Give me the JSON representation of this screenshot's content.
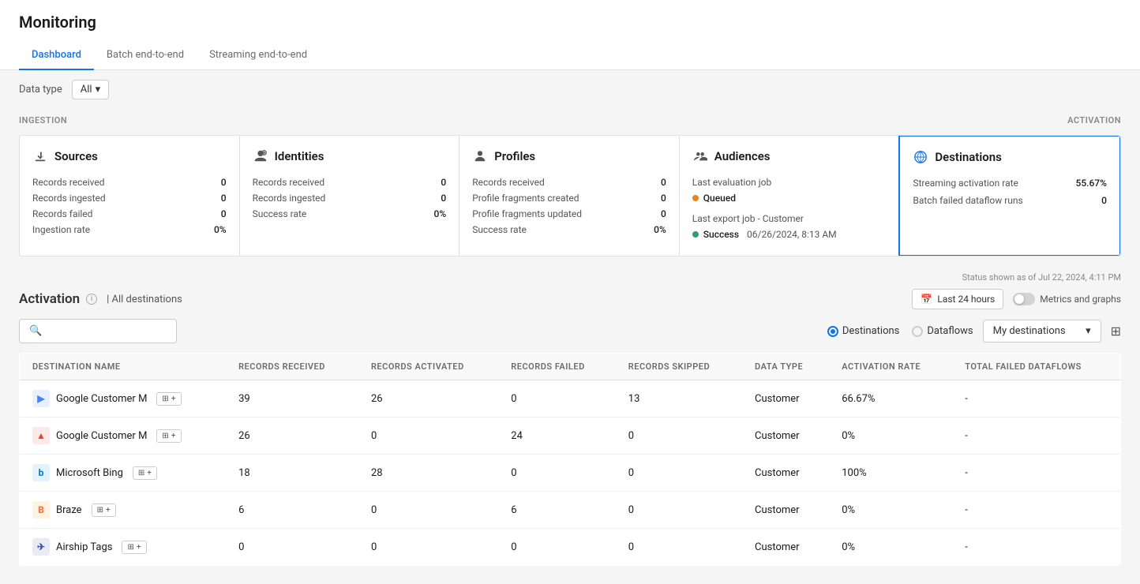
{
  "page": {
    "title": "Monitoring"
  },
  "tabs": [
    {
      "label": "Dashboard",
      "active": true
    },
    {
      "label": "Batch end-to-end",
      "active": false
    },
    {
      "label": "Streaming end-to-end",
      "active": false
    }
  ],
  "toolbar": {
    "data_type_label": "Data type",
    "data_type_value": "All"
  },
  "section_labels": {
    "ingestion": "INGESTION",
    "activation": "ACTIVATION"
  },
  "cards": {
    "sources": {
      "title": "Sources",
      "records_received_label": "Records received",
      "records_received_value": "0",
      "records_ingested_label": "Records ingested",
      "records_ingested_value": "0",
      "records_failed_label": "Records failed",
      "records_failed_value": "0",
      "ingestion_rate_label": "Ingestion rate",
      "ingestion_rate_value": "0%"
    },
    "identities": {
      "title": "Identities",
      "records_received_label": "Records received",
      "records_received_value": "0",
      "records_ingested_label": "Records ingested",
      "records_ingested_value": "0",
      "success_rate_label": "Success rate",
      "success_rate_value": "0%"
    },
    "profiles": {
      "title": "Profiles",
      "records_received_label": "Records received",
      "records_received_value": "0",
      "fragments_created_label": "Profile fragments created",
      "fragments_created_value": "0",
      "fragments_updated_label": "Profile fragments updated",
      "fragments_updated_value": "0",
      "success_rate_label": "Success rate",
      "success_rate_value": "0%"
    },
    "audiences": {
      "title": "Audiences",
      "eval_job_label": "Last evaluation job",
      "status_queued": "Queued",
      "export_job_label": "Last export job - Customer",
      "status_success": "Success",
      "success_time": "06/26/2024, 8:13 AM"
    },
    "destinations": {
      "title": "Destinations",
      "streaming_rate_label": "Streaming activation rate",
      "streaming_rate_value": "55.67%",
      "batch_failed_label": "Batch failed dataflow runs",
      "batch_failed_value": "0"
    }
  },
  "status_footer": "Status shown as of Jul 22, 2024, 4:11 PM",
  "activation_section": {
    "title": "Activation",
    "all_destinations_label": "| All destinations",
    "last_hours_label": "Last 24 hours",
    "metrics_label": "Metrics and graphs",
    "search_placeholder": "",
    "radio_destinations": "Destinations",
    "radio_dataflows": "Dataflows",
    "dropdown_value": "My destinations",
    "table_headers": [
      "DESTINATION NAME",
      "RECORDS RECEIVED",
      "RECORDS ACTIVATED",
      "RECORDS FAILED",
      "RECORDS SKIPPED",
      "DATA TYPE",
      "ACTIVATION RATE",
      "TOTAL FAILED DATAFLOWS"
    ],
    "rows": [
      {
        "name": "Google Customer M",
        "logo_type": "google-cm",
        "logo_text": "▶",
        "records_received": "39",
        "records_activated": "26",
        "records_failed": "0",
        "records_skipped": "13",
        "data_type": "Customer",
        "activation_rate": "66.67%",
        "total_failed": "-"
      },
      {
        "name": "Google Customer M",
        "logo_type": "google-ads",
        "logo_text": "▲",
        "records_received": "26",
        "records_activated": "0",
        "records_failed": "24",
        "records_skipped": "0",
        "data_type": "Customer",
        "activation_rate": "0%",
        "total_failed": "-"
      },
      {
        "name": "Microsoft Bing",
        "logo_type": "ms-bing",
        "logo_text": "b",
        "records_received": "18",
        "records_activated": "28",
        "records_failed": "0",
        "records_skipped": "0",
        "data_type": "Customer",
        "activation_rate": "100%",
        "total_failed": "-"
      },
      {
        "name": "Braze",
        "logo_type": "braze",
        "logo_text": "B",
        "records_received": "6",
        "records_activated": "0",
        "records_failed": "6",
        "records_skipped": "0",
        "data_type": "Customer",
        "activation_rate": "0%",
        "total_failed": "-"
      },
      {
        "name": "Airship Tags",
        "logo_type": "airship",
        "logo_text": "✈",
        "records_received": "0",
        "records_activated": "0",
        "records_failed": "0",
        "records_skipped": "0",
        "data_type": "Customer",
        "activation_rate": "0%",
        "total_failed": "-"
      }
    ]
  },
  "colors": {
    "active_blue": "#1473e6",
    "orange": "#e68619",
    "green": "#2d9d78"
  }
}
